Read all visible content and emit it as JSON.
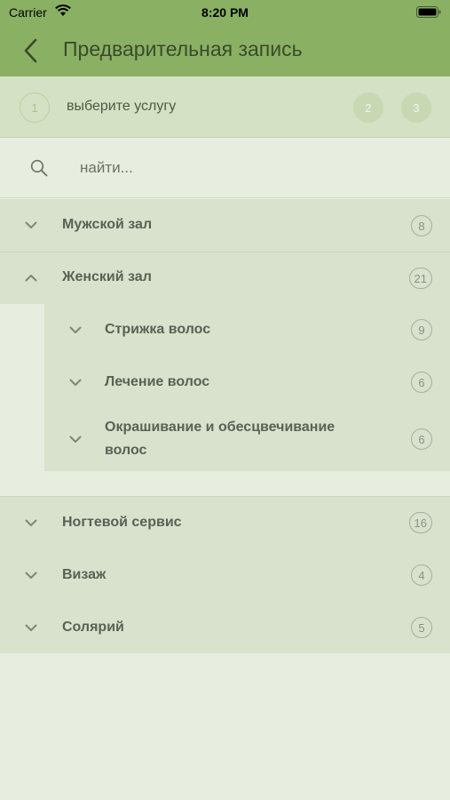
{
  "status_bar": {
    "carrier": "Carrier",
    "time": "8:20 PM"
  },
  "nav": {
    "title": "Предварительная запись"
  },
  "steps": {
    "current_number": "1",
    "current_label": "выберите услугу",
    "step2": "2",
    "step3": "3"
  },
  "search": {
    "placeholder": "найти..."
  },
  "categories": [
    {
      "label": "Мужской зал",
      "count": "8",
      "expanded": false
    },
    {
      "label": "Женский зал",
      "count": "21",
      "expanded": true,
      "subcategories": [
        {
          "label": "Стрижка волос",
          "count": "9"
        },
        {
          "label": "Лечение волос",
          "count": "6"
        },
        {
          "label": "Окрашивание и обесцвечивание волос",
          "label_line1": "Окрашивание и обесцвечивание",
          "label_line2": "волос",
          "count": "6"
        }
      ]
    },
    {
      "label": "Ногтевой сервис",
      "count": "16",
      "expanded": false
    },
    {
      "label": "Визаж",
      "count": "4",
      "expanded": false
    },
    {
      "label": "Солярий",
      "count": "5",
      "expanded": false
    }
  ],
  "colors": {
    "header": "#8ab064",
    "steps_bg": "#d4e1c4",
    "page_bg": "#e7eedf",
    "row_bg": "#d8e2cd"
  }
}
